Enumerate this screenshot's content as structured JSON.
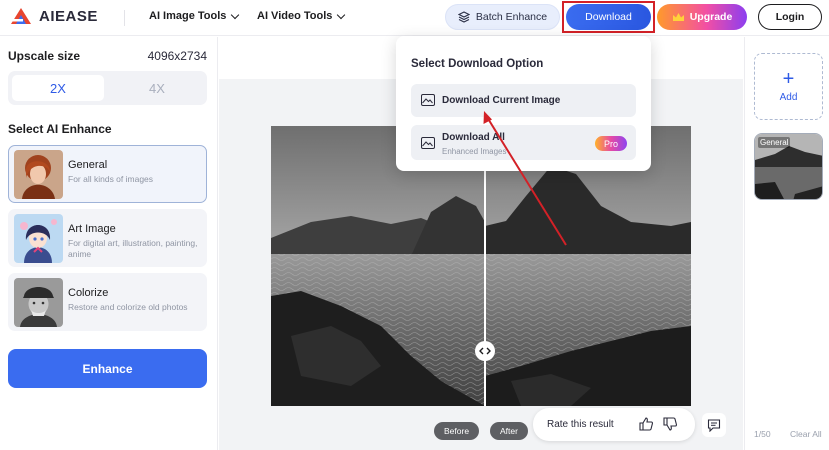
{
  "brand": {
    "name": "AIEASE"
  },
  "nav": {
    "image_tools": "AI Image Tools",
    "video_tools": "AI Video Tools"
  },
  "header": {
    "batch_label": "Batch Enhance",
    "download_label": "Download",
    "upgrade_label": "Upgrade",
    "login_label": "Login"
  },
  "left": {
    "upscale_label": "Upscale size",
    "upscale_value": "4096x2734",
    "scale_options": [
      "2X",
      "4X"
    ],
    "selected_scale": "2X",
    "enhance_title": "Select AI Enhance",
    "cards": [
      {
        "title": "General",
        "desc": "For all kinds of images",
        "selected": true
      },
      {
        "title": "Art Image",
        "desc": "For digital art, illustration, painting, anime",
        "selected": false
      },
      {
        "title": "Colorize",
        "desc": "Restore and colorize old photos",
        "selected": false
      }
    ],
    "enhance_button": "Enhance"
  },
  "dropdown": {
    "title": "Select Download Option",
    "current_label": "Download Current Image",
    "all_label": "Download All",
    "all_sub": "Enhanced Images",
    "pro_badge": "Pro"
  },
  "compare": {
    "before_label": "Before",
    "after_label": "After",
    "split_fraction": 0.51
  },
  "feedback": {
    "rate_label": "Rate this result"
  },
  "right": {
    "add_label": "Add",
    "thumb_label": "General",
    "count": "1/50",
    "clear_label": "Clear All"
  },
  "colors": {
    "accent": "#3a6cf0",
    "highlight_box": "#d32127",
    "arrow": "#d32127"
  }
}
